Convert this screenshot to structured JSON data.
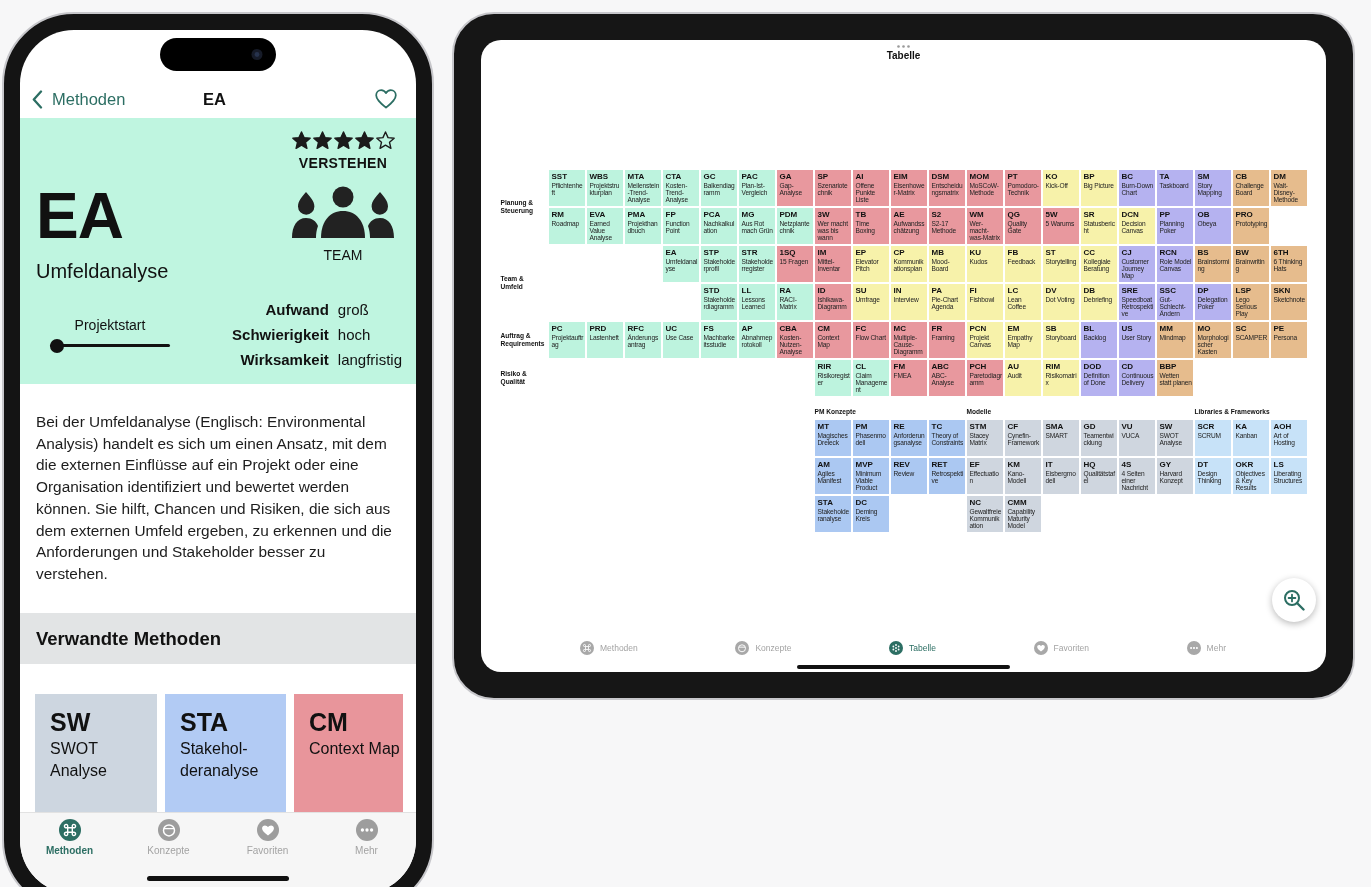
{
  "phone": {
    "nav": {
      "back_label": "Methoden",
      "title": "EA",
      "favorite": false
    },
    "hero": {
      "stars": 4,
      "category": "VERSTEHEN",
      "code": "EA",
      "name": "Umfeldanalyse",
      "audience": "TEAM",
      "timing": {
        "label": "Projektstart",
        "level": 0
      },
      "attributes": [
        {
          "label": "Aufwand",
          "value": "groß"
        },
        {
          "label": "Schwierigkeit",
          "value": "hoch"
        },
        {
          "label": "Wirksamkeit",
          "value": "langfristig"
        }
      ]
    },
    "description": "Bei der Umfeldanalyse (Englisch: Environmental Analysis) handelt es sich um einen Ansatz, mit dem die externen Einflüsse auf ein Projekt oder eine Organisation identifiziert und bewertet werden können. Sie hilft, Chancen und Risiken, die sich aus dem externen Umfeld ergeben, zu erkennen und die Anforderungen und Stakeholder besser zu verstehen.",
    "related": {
      "title": "Verwandte Methoden",
      "cards": [
        {
          "code": "SW",
          "name": "SWOT Analyse",
          "color": "#cdd6e0"
        },
        {
          "code": "STA",
          "name": "Stakehol-deranalyse",
          "color": "#b2cbf4"
        },
        {
          "code": "CM",
          "name": "Context Map",
          "color": "#e8959b"
        }
      ]
    },
    "tab_bar": [
      {
        "label": "Methoden",
        "selected": true
      },
      {
        "label": "Konzepte",
        "selected": false
      },
      {
        "label": "Favoriten",
        "selected": false
      },
      {
        "label": "Mehr",
        "selected": false
      }
    ]
  },
  "tablet": {
    "title": "Tabelle",
    "table": {
      "row_groups": [
        {
          "label": "Planung & Steuerung",
          "rows": [
            [
              {
                "kind": "method",
                "code": "SST",
                "name": "Pflichtenheft",
                "color": "#bdf3de"
              },
              {
                "kind": "method",
                "code": "WBS",
                "name": "Projektstrukturplan",
                "color": "#bdf3de"
              },
              {
                "kind": "method",
                "code": "MTA",
                "name": "Meilenstein-Trend-Analyse",
                "color": "#bdf3de"
              },
              {
                "kind": "method",
                "code": "CTA",
                "name": "Kosten-Trend-Analyse",
                "color": "#bdf3de"
              },
              {
                "kind": "method",
                "code": "GC",
                "name": "Balkendiagramm",
                "color": "#bdf3de"
              },
              {
                "kind": "method",
                "code": "PAC",
                "name": "Plan-Ist-Vergleich",
                "color": "#bdf3de"
              },
              {
                "kind": "method",
                "code": "GA",
                "name": "Gap-Analyse",
                "color": "#e8989e"
              },
              {
                "kind": "method",
                "code": "SP",
                "name": "Szenariotechnik",
                "color": "#e8989e"
              },
              {
                "kind": "method",
                "code": "AI",
                "name": "Offene Punkte Liste",
                "color": "#e8989e"
              },
              {
                "kind": "method",
                "code": "EIM",
                "name": "Eisenhower-Matrix",
                "color": "#e8989e"
              },
              {
                "kind": "method",
                "code": "DSM",
                "name": "Entscheidungsmatrix",
                "color": "#e8989e"
              },
              {
                "kind": "method",
                "code": "MOM",
                "name": "MoSCoW-Methode",
                "color": "#e8989e"
              },
              {
                "kind": "method",
                "code": "PT",
                "name": "Pomodoro-Technik",
                "color": "#e8989e"
              },
              {
                "kind": "method",
                "code": "KO",
                "name": "Kick-Off",
                "color": "#f7f2aa"
              },
              {
                "kind": "method",
                "code": "BP",
                "name": "Big Picture",
                "color": "#f7f2aa"
              },
              {
                "kind": "method",
                "code": "BC",
                "name": "Burn-Down Chart",
                "color": "#b5b2f0"
              },
              {
                "kind": "method",
                "code": "TA",
                "name": "Taskboard",
                "color": "#b5b2f0"
              },
              {
                "kind": "method",
                "code": "SM",
                "name": "Story Mapping",
                "color": "#b5b2f0"
              },
              {
                "kind": "method",
                "code": "CB",
                "name": "Challenge Board",
                "color": "#e6bc8d"
              },
              {
                "kind": "method",
                "code": "DM",
                "name": "Walt-Disney-Methode",
                "color": "#e6bc8d"
              }
            ],
            [
              {
                "kind": "method",
                "code": "RM",
                "name": "Roadmap",
                "color": "#bdf3de"
              },
              {
                "kind": "method",
                "code": "EVA",
                "name": "Earned Value Analyse",
                "color": "#bdf3de"
              },
              {
                "kind": "method",
                "code": "PMA",
                "name": "Projekthandbuch",
                "color": "#bdf3de"
              },
              {
                "kind": "method",
                "code": "FP",
                "name": "Function Point",
                "color": "#bdf3de"
              },
              {
                "kind": "method",
                "code": "PCA",
                "name": "Nachkalkulation",
                "color": "#bdf3de"
              },
              {
                "kind": "method",
                "code": "MG",
                "name": "Aus Rot mach Grün",
                "color": "#bdf3de"
              },
              {
                "kind": "method",
                "code": "PDM",
                "name": "Netzplantechnik",
                "color": "#bdf3de"
              },
              {
                "kind": "method",
                "code": "3W",
                "name": "Wer macht was bis wann",
                "color": "#e8989e"
              },
              {
                "kind": "method",
                "code": "TB",
                "name": "Time Boxing",
                "color": "#e8989e"
              },
              {
                "kind": "method",
                "code": "AE",
                "name": "Aufwandsschätzung",
                "color": "#e8989e"
              },
              {
                "kind": "method",
                "code": "S2",
                "name": "S2-17 Methode",
                "color": "#e8989e"
              },
              {
                "kind": "method",
                "code": "WM",
                "name": "Wer-macht-was-Matrix",
                "color": "#e8989e"
              },
              {
                "kind": "method",
                "code": "QG",
                "name": "Quality Gate",
                "color": "#e8989e"
              },
              {
                "kind": "method",
                "code": "5W",
                "name": "5 Warums",
                "color": "#e8989e"
              },
              {
                "kind": "method",
                "code": "SR",
                "name": "Statusbericht",
                "color": "#f7f2aa"
              },
              {
                "kind": "method",
                "code": "DCN",
                "name": "Decision Canvas",
                "color": "#f7f2aa"
              },
              {
                "kind": "method",
                "code": "PP",
                "name": "Planning Poker",
                "color": "#b5b2f0"
              },
              {
                "kind": "method",
                "code": "OB",
                "name": "Obeya",
                "color": "#b5b2f0"
              },
              {
                "kind": "method",
                "code": "PRO",
                "name": "Prototyping",
                "color": "#e6bc8d"
              }
            ]
          ]
        },
        {
          "label": "Team & Umfeld",
          "rows": [
            [
              {
                "kind": "empty"
              },
              {
                "kind": "empty"
              },
              {
                "kind": "empty"
              },
              {
                "kind": "method",
                "code": "EA",
                "name": "Umfeldanalyse",
                "color": "#bdf3de"
              },
              {
                "kind": "method",
                "code": "STP",
                "name": "Stakeholderprofil",
                "color": "#bdf3de"
              },
              {
                "kind": "method",
                "code": "STR",
                "name": "Stakeholderregister",
                "color": "#bdf3de"
              },
              {
                "kind": "method",
                "code": "1SQ",
                "name": "15 Fragen",
                "color": "#e8989e"
              },
              {
                "kind": "method",
                "code": "IM",
                "name": "Mittel-Inventar",
                "color": "#e8989e"
              },
              {
                "kind": "method",
                "code": "EP",
                "name": "Elevator Pitch",
                "color": "#f7f2aa"
              },
              {
                "kind": "method",
                "code": "CP",
                "name": "Kommunikationsplan",
                "color": "#f7f2aa"
              },
              {
                "kind": "method",
                "code": "MB",
                "name": "Mood-Board",
                "color": "#f7f2aa"
              },
              {
                "kind": "method",
                "code": "KU",
                "name": "Kudos",
                "color": "#f7f2aa"
              },
              {
                "kind": "method",
                "code": "FB",
                "name": "Feedback",
                "color": "#f7f2aa"
              },
              {
                "kind": "method",
                "code": "ST",
                "name": "Storytelling",
                "color": "#f7f2aa"
              },
              {
                "kind": "method",
                "code": "CC",
                "name": "Kollegiale Beratung",
                "color": "#f7f2aa"
              },
              {
                "kind": "method",
                "code": "CJ",
                "name": "Customer Journey Map",
                "color": "#b5b2f0"
              },
              {
                "kind": "method",
                "code": "RCN",
                "name": "Role Model Canvas",
                "color": "#b5b2f0"
              },
              {
                "kind": "method",
                "code": "BS",
                "name": "Brainstorming",
                "color": "#e6bc8d"
              },
              {
                "kind": "method",
                "code": "BW",
                "name": "Brainwriting",
                "color": "#e6bc8d"
              },
              {
                "kind": "method",
                "code": "6TH",
                "name": "6 Thinking Hats",
                "color": "#e6bc8d"
              }
            ],
            [
              {
                "kind": "empty"
              },
              {
                "kind": "empty"
              },
              {
                "kind": "empty"
              },
              {
                "kind": "empty"
              },
              {
                "kind": "method",
                "code": "STD",
                "name": "Stakeholderdiagramm",
                "color": "#bdf3de"
              },
              {
                "kind": "method",
                "code": "LL",
                "name": "Lessons Learned",
                "color": "#bdf3de"
              },
              {
                "kind": "method",
                "code": "RA",
                "name": "RACI-Matrix",
                "color": "#bdf3de"
              },
              {
                "kind": "method",
                "code": "ID",
                "name": "Ishikawa-Diagramm",
                "color": "#e8989e"
              },
              {
                "kind": "method",
                "code": "SU",
                "name": "Umfrage",
                "color": "#f7f2aa"
              },
              {
                "kind": "method",
                "code": "IN",
                "name": "Interview",
                "color": "#f7f2aa"
              },
              {
                "kind": "method",
                "code": "PA",
                "name": "Pie-Chart Agenda",
                "color": "#f7f2aa"
              },
              {
                "kind": "method",
                "code": "FI",
                "name": "Fishbowl",
                "color": "#f7f2aa"
              },
              {
                "kind": "method",
                "code": "LC",
                "name": "Lean Coffee",
                "color": "#f7f2aa"
              },
              {
                "kind": "method",
                "code": "DV",
                "name": "Dot Voting",
                "color": "#f7f2aa"
              },
              {
                "kind": "method",
                "code": "DB",
                "name": "Debriefing",
                "color": "#f7f2aa"
              },
              {
                "kind": "method",
                "code": "SRE",
                "name": "Speedboat Retrospektive",
                "color": "#b5b2f0"
              },
              {
                "kind": "method",
                "code": "SSC",
                "name": "Gut-Schlecht-Ändern",
                "color": "#b5b2f0"
              },
              {
                "kind": "method",
                "code": "DP",
                "name": "Delegation Poker",
                "color": "#b5b2f0"
              },
              {
                "kind": "method",
                "code": "LSP",
                "name": "Lego Serious Play",
                "color": "#e6bc8d"
              },
              {
                "kind": "method",
                "code": "SKN",
                "name": "Sketchnote",
                "color": "#e6bc8d"
              }
            ]
          ]
        },
        {
          "label": "Auftrag & Requirements",
          "rows": [
            [
              {
                "kind": "method",
                "code": "PC",
                "name": "Projektauftrag",
                "color": "#bdf3de"
              },
              {
                "kind": "method",
                "code": "PRD",
                "name": "Lastenheft",
                "color": "#bdf3de"
              },
              {
                "kind": "method",
                "code": "RFC",
                "name": "Änderungsantrag",
                "color": "#bdf3de"
              },
              {
                "kind": "method",
                "code": "UC",
                "name": "Use Case",
                "color": "#bdf3de"
              },
              {
                "kind": "method",
                "code": "FS",
                "name": "Machbarkeitsstudie",
                "color": "#bdf3de"
              },
              {
                "kind": "method",
                "code": "AP",
                "name": "Abnahmeprotokoll",
                "color": "#bdf3de"
              },
              {
                "kind": "method",
                "code": "CBA",
                "name": "Kosten-Nutzen-Analyse",
                "color": "#e8989e"
              },
              {
                "kind": "method",
                "code": "CM",
                "name": "Context Map",
                "color": "#e8989e"
              },
              {
                "kind": "method",
                "code": "FC",
                "name": "Flow Chart",
                "color": "#e8989e"
              },
              {
                "kind": "method",
                "code": "MC",
                "name": "Multiple-Cause-Diagramm",
                "color": "#e8989e"
              },
              {
                "kind": "method",
                "code": "FR",
                "name": "Framing",
                "color": "#e8989e"
              },
              {
                "kind": "method",
                "code": "PCN",
                "name": "Projekt Canvas",
                "color": "#f7f2aa"
              },
              {
                "kind": "method",
                "code": "EM",
                "name": "Empathy Map",
                "color": "#f7f2aa"
              },
              {
                "kind": "method",
                "code": "SB",
                "name": "Storyboard",
                "color": "#f7f2aa"
              },
              {
                "kind": "method",
                "code": "BL",
                "name": "Backlog",
                "color": "#b5b2f0"
              },
              {
                "kind": "method",
                "code": "US",
                "name": "User Story",
                "color": "#b5b2f0"
              },
              {
                "kind": "method",
                "code": "MM",
                "name": "Mindmap",
                "color": "#e6bc8d"
              },
              {
                "kind": "method",
                "code": "MO",
                "name": "Morphologischer Kasten",
                "color": "#e6bc8d"
              },
              {
                "kind": "method",
                "code": "SC",
                "name": "SCAMPER",
                "color": "#e6bc8d"
              },
              {
                "kind": "method",
                "code": "PE",
                "name": "Persona",
                "color": "#e6bc8d"
              }
            ]
          ]
        },
        {
          "label": "Risiko & Qualität",
          "rows": [
            [
              {
                "kind": "empty"
              },
              {
                "kind": "empty"
              },
              {
                "kind": "empty"
              },
              {
                "kind": "empty"
              },
              {
                "kind": "empty"
              },
              {
                "kind": "empty"
              },
              {
                "kind": "empty"
              },
              {
                "kind": "method",
                "code": "RIR",
                "name": "Risikoregister",
                "color": "#bdf3de"
              },
              {
                "kind": "method",
                "code": "CL",
                "name": "Claim Management",
                "color": "#bdf3de"
              },
              {
                "kind": "method",
                "code": "FM",
                "name": "FMEA",
                "color": "#e8989e"
              },
              {
                "kind": "method",
                "code": "ABC",
                "name": "ABC-Analyse",
                "color": "#e8989e"
              },
              {
                "kind": "method",
                "code": "PCH",
                "name": "Paretodiagramm",
                "color": "#e8989e"
              },
              {
                "kind": "method",
                "code": "AU",
                "name": "Audit",
                "color": "#f7f2aa"
              },
              {
                "kind": "method",
                "code": "RIM",
                "name": "Risikomatrix",
                "color": "#f7f2aa"
              },
              {
                "kind": "method",
                "code": "DOD",
                "name": "Definition of Done",
                "color": "#b5b2f0"
              },
              {
                "kind": "method",
                "code": "CD",
                "name": "Continuous Delivery",
                "color": "#b5b2f0"
              },
              {
                "kind": "method",
                "code": "BBP",
                "name": "Wetten statt planen",
                "color": "#e6bc8d"
              }
            ]
          ]
        }
      ],
      "column_groups": [
        {
          "label": "PM Konzepte",
          "rows": [
            [
              {
                "kind": "method",
                "code": "MT",
                "name": "Magisches Dreieck",
                "color": "#abc8f2"
              },
              {
                "kind": "method",
                "code": "PM",
                "name": "Phasenmodell",
                "color": "#abc8f2"
              },
              {
                "kind": "method",
                "code": "RE",
                "name": "Anforderungsanalyse",
                "color": "#abc8f2"
              },
              {
                "kind": "method",
                "code": "TC",
                "name": "Theory of Constraints",
                "color": "#abc8f2"
              }
            ],
            [
              {
                "kind": "method",
                "code": "AM",
                "name": "Agiles Manifest",
                "color": "#abc8f2"
              },
              {
                "kind": "method",
                "code": "MVP",
                "name": "Minimum Viable Product",
                "color": "#abc8f2"
              },
              {
                "kind": "method",
                "code": "REV",
                "name": "Review",
                "color": "#abc8f2"
              },
              {
                "kind": "method",
                "code": "RET",
                "name": "Retrospektive",
                "color": "#abc8f2"
              }
            ],
            [
              {
                "kind": "method",
                "code": "STA",
                "name": "Stakeholderanalyse",
                "color": "#abc8f2"
              },
              {
                "kind": "method",
                "code": "DC",
                "name": "Deming Kreis",
                "color": "#abc8f2"
              }
            ]
          ]
        },
        {
          "label": "Modelle",
          "rows": [
            [
              {
                "kind": "method",
                "code": "STM",
                "name": "Stacey Matrix",
                "color": "#cfd6df"
              },
              {
                "kind": "method",
                "code": "CF",
                "name": "Cynefin-Framework",
                "color": "#cfd6df"
              },
              {
                "kind": "method",
                "code": "SMA",
                "name": "SMART",
                "color": "#cfd6df"
              },
              {
                "kind": "method",
                "code": "GD",
                "name": "Teamentwicklung",
                "color": "#cfd6df"
              },
              {
                "kind": "method",
                "code": "VU",
                "name": "VUCA",
                "color": "#cfd6df"
              },
              {
                "kind": "method",
                "code": "SW",
                "name": "SWOT Analyse",
                "color": "#cfd6df"
              }
            ],
            [
              {
                "kind": "method",
                "code": "EF",
                "name": "Effectuation",
                "color": "#cfd6df"
              },
              {
                "kind": "method",
                "code": "KM",
                "name": "Kano-Modell",
                "color": "#cfd6df"
              },
              {
                "kind": "method",
                "code": "IT",
                "name": "Eisbergmodell",
                "color": "#cfd6df"
              },
              {
                "kind": "method",
                "code": "HQ",
                "name": "Qualitätstafel",
                "color": "#cfd6df"
              },
              {
                "kind": "method",
                "code": "4S",
                "name": "4 Seiten einer Nachricht",
                "color": "#cfd6df"
              },
              {
                "kind": "method",
                "code": "GY",
                "name": "Harvard Konzept",
                "color": "#cfd6df"
              }
            ],
            [
              {
                "kind": "method",
                "code": "NC",
                "name": "Gewaltfreie Kommunikation",
                "color": "#cfd6df"
              },
              {
                "kind": "method",
                "code": "CMM",
                "name": "Capability Maturity Model",
                "color": "#cfd6df"
              }
            ]
          ]
        },
        {
          "label": "Libraries & Frameworks",
          "rows": [
            [
              {
                "kind": "method",
                "code": "SCR",
                "name": "SCRUM",
                "color": "#c7e2f8"
              },
              {
                "kind": "method",
                "code": "KA",
                "name": "Kanban",
                "color": "#c7e2f8"
              },
              {
                "kind": "method",
                "code": "AOH",
                "name": "Art of Hosting",
                "color": "#c7e2f8"
              }
            ],
            [
              {
                "kind": "method",
                "code": "DT",
                "name": "Design Thinking",
                "color": "#c7e2f8"
              },
              {
                "kind": "method",
                "code": "OKR",
                "name": "Objectives & Key Results",
                "color": "#c7e2f8"
              },
              {
                "kind": "method",
                "code": "LS",
                "name": "Liberating Structures",
                "color": "#c7e2f8"
              }
            ]
          ]
        }
      ]
    },
    "tab_bar": [
      {
        "label": "Methoden",
        "selected": false
      },
      {
        "label": "Konzepte",
        "selected": false
      },
      {
        "label": "Tabelle",
        "selected": true
      },
      {
        "label": "Favoriten",
        "selected": false
      },
      {
        "label": "Mehr",
        "selected": false
      }
    ]
  }
}
